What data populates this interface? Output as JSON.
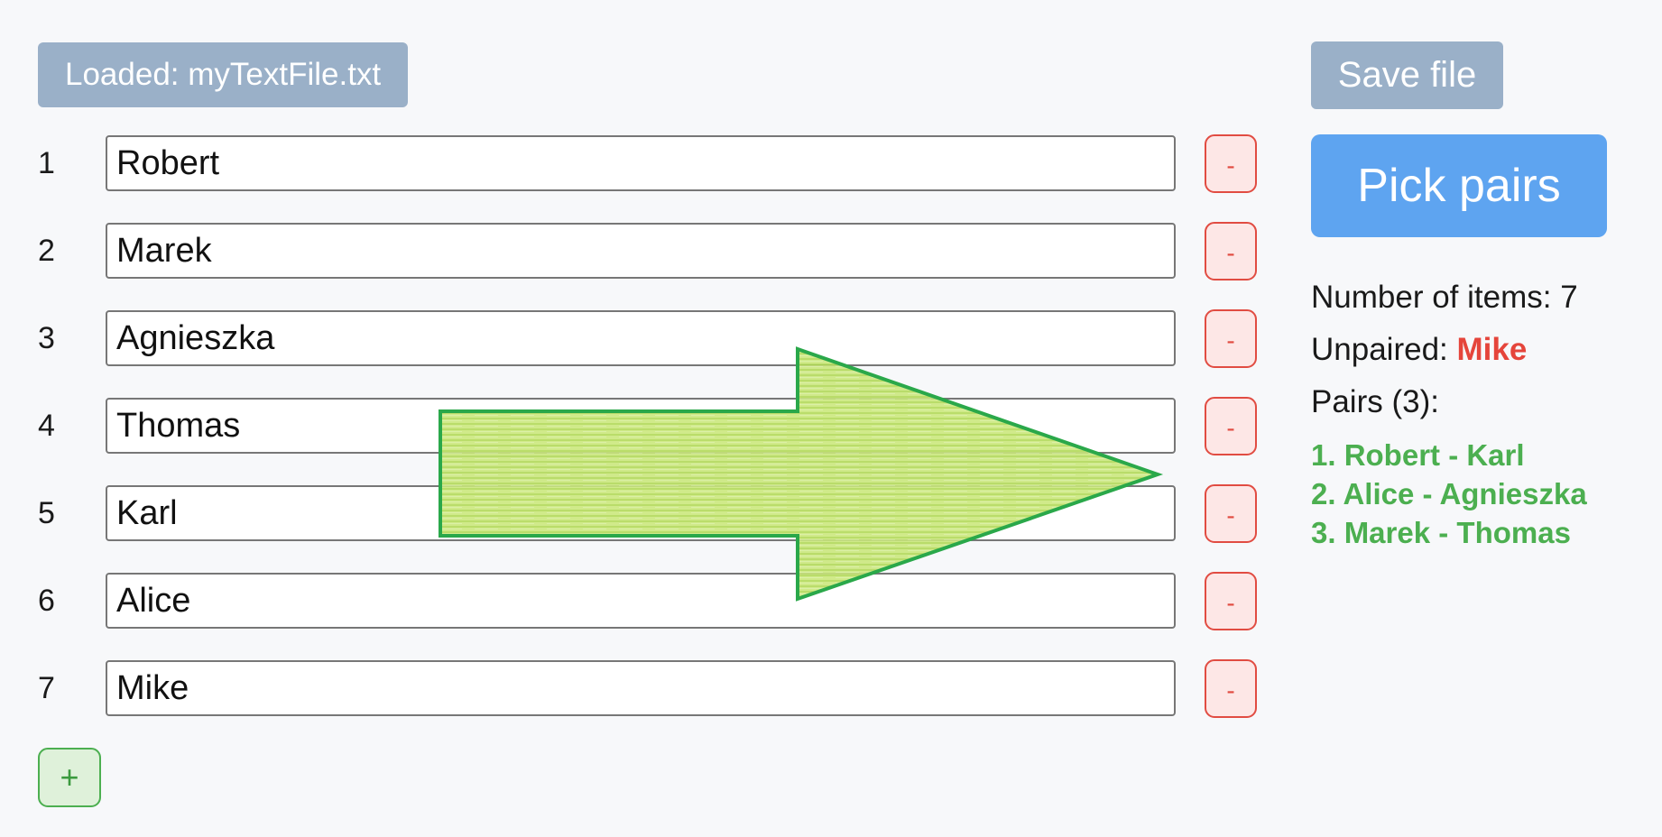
{
  "loaded_label": "Loaded: myTextFile.txt",
  "save_label": "Save file",
  "pick_label": "Pick pairs",
  "items": [
    {
      "num": "1",
      "value": "Robert"
    },
    {
      "num": "2",
      "value": "Marek"
    },
    {
      "num": "3",
      "value": "Agnieszka"
    },
    {
      "num": "4",
      "value": "Thomas"
    },
    {
      "num": "5",
      "value": "Karl"
    },
    {
      "num": "6",
      "value": "Alice"
    },
    {
      "num": "7",
      "value": "Mike"
    }
  ],
  "remove_label": "-",
  "add_label": "+",
  "stats": {
    "count_label": "Number of items: 7",
    "unpaired_label": "Unpaired:",
    "unpaired_name": "Mike",
    "pairs_label": "Pairs (3):",
    "pairs": [
      "1. Robert - Karl",
      "2. Alice - Agnieszka",
      "3. Marek - Thomas"
    ]
  },
  "colors": {
    "accent": "#5ea4f0",
    "muted_button": "#9ab0c8",
    "danger": "#e14c42",
    "success": "#4caf50",
    "arrow_fill": "#b5dc5a",
    "arrow_stroke": "#2aa84a"
  },
  "overlay": {
    "arrow_icon": "right-arrow-icon"
  }
}
